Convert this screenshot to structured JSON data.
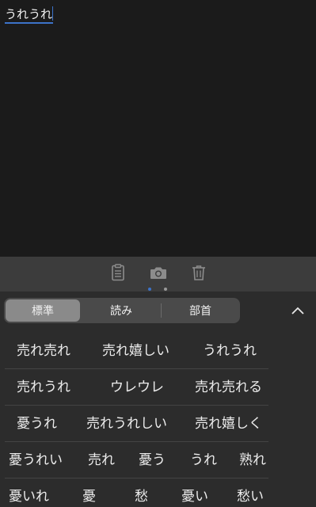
{
  "editor": {
    "composing_text": "うれうれ"
  },
  "toolbar": {
    "buttons": [
      {
        "icon": "clipboard-icon"
      },
      {
        "icon": "camera-icon"
      },
      {
        "icon": "trash-icon"
      }
    ],
    "page_count": 2,
    "active_page": 1
  },
  "tabs": {
    "items": [
      "標準",
      "読み",
      "部首"
    ],
    "selected": "標準",
    "collapse_icon": "chevron-up-icon"
  },
  "candidates": [
    [
      "売れ売れ",
      "売れ嬉しい",
      "うれうれ"
    ],
    [
      "売れうれ",
      "ウレウレ",
      "売れ売れる"
    ],
    [
      "憂うれ",
      "売れうれしい",
      "売れ嬉しく"
    ],
    [
      "憂うれい",
      "売れ",
      "憂う",
      "うれ",
      "熟れ"
    ],
    [
      "憂いれ",
      "憂",
      "愁",
      "憂い",
      "愁い"
    ]
  ],
  "colors": {
    "background": "#1b1b1b",
    "keyboard": "#2c2c2c",
    "accent": "#3d73c9"
  }
}
